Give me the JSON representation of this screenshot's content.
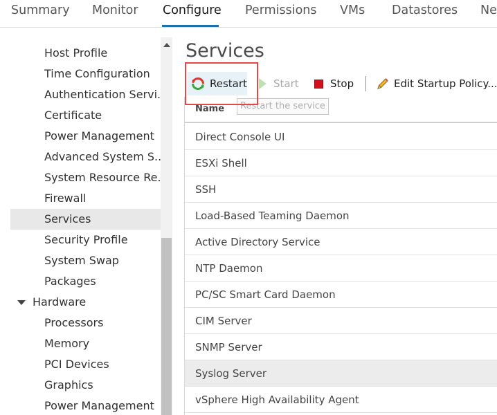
{
  "tabs": [
    "Summary",
    "Monitor",
    "Configure",
    "Permissions",
    "VMs",
    "Datastores",
    "Ne"
  ],
  "active_tab": "Configure",
  "sidebar": {
    "items": [
      "Host Profile",
      "Time Configuration",
      "Authentication Servi...",
      "Certificate",
      "Power Management",
      "Advanced System S...",
      "System Resource Re...",
      "Firewall",
      "Services",
      "Security Profile",
      "System Swap",
      "Packages"
    ],
    "selected": "Services",
    "group": "Hardware",
    "group_items": [
      "Processors",
      "Memory",
      "PCI Devices",
      "Graphics",
      "Power Management"
    ]
  },
  "page": {
    "title": "Services"
  },
  "toolbar": {
    "restart": "Restart",
    "start": "Start",
    "stop": "Stop",
    "edit": "Edit Startup Policy..."
  },
  "tooltip": "Restart the service",
  "table": {
    "header": "Name",
    "rows": [
      "Direct Console UI",
      "ESXi Shell",
      "SSH",
      "Load-Based Teaming Daemon",
      "Active Directory Service",
      "NTP Daemon",
      "PC/SC Smart Card Daemon",
      "CIM Server",
      "SNMP Server",
      "Syslog Server",
      "vSphere High Availability Agent"
    ],
    "selected": "Syslog Server"
  },
  "colors": {
    "accent": "#1c6fa8",
    "stop": "#d0111b",
    "highlight": "#e14848",
    "selected_row": "#ececec"
  }
}
